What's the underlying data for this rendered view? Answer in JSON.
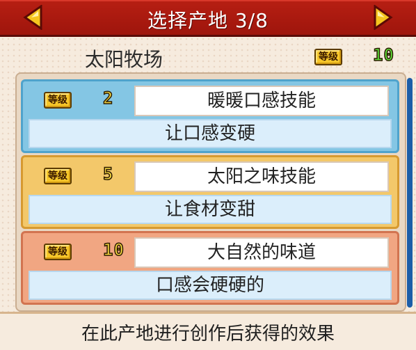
{
  "header": {
    "title": "选择产地 3/8",
    "prev_icon": "triangle-left-icon",
    "next_icon": "triangle-right-icon",
    "color": "#b71f13"
  },
  "farm": {
    "name": "太阳牧场",
    "level_label": "等级",
    "level_value": "10"
  },
  "skills": [
    {
      "level_label": "等级",
      "level_value": "2",
      "name": "暖暖口感技能",
      "description": "让口感变硬",
      "theme": "blue"
    },
    {
      "level_label": "等级",
      "level_value": "5",
      "name": "太阳之味技能",
      "description": "让食材变甜",
      "theme": "yellow"
    },
    {
      "level_label": "等级",
      "level_value": "10",
      "name": "大自然的味道",
      "description": "口感会硬硬的",
      "theme": "orange"
    }
  ],
  "footer": {
    "text": "在此产地进行创作后获得的效果"
  }
}
